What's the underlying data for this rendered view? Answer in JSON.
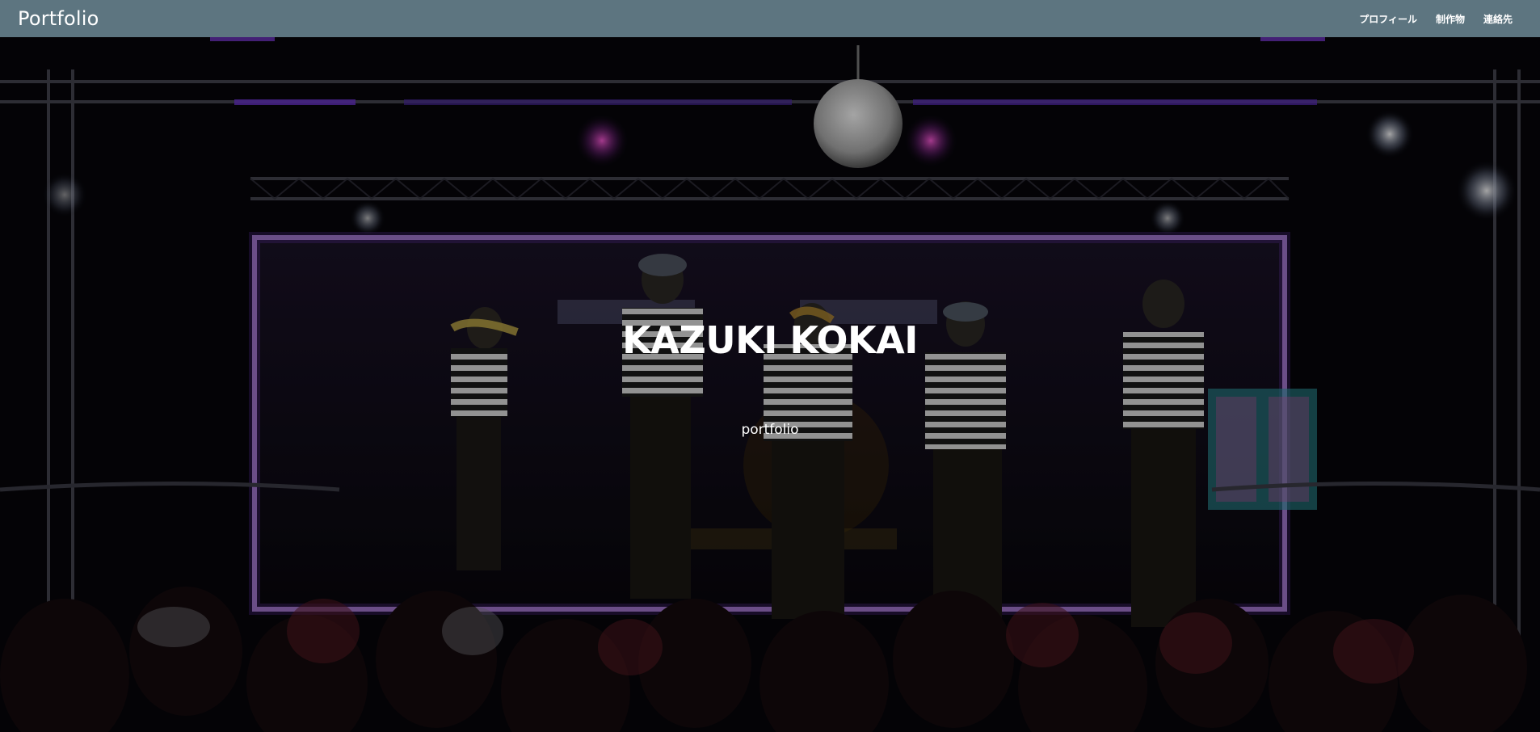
{
  "navbar": {
    "brand": "Portfolio",
    "links": [
      {
        "label": "プロフィール"
      },
      {
        "label": "制作物"
      },
      {
        "label": "連絡先"
      }
    ],
    "background_color": "#5d7580"
  },
  "hero": {
    "title": "KAZUKI KOKAI",
    "subtitle": "portfolio",
    "background_image": "stage-performance-photo"
  }
}
